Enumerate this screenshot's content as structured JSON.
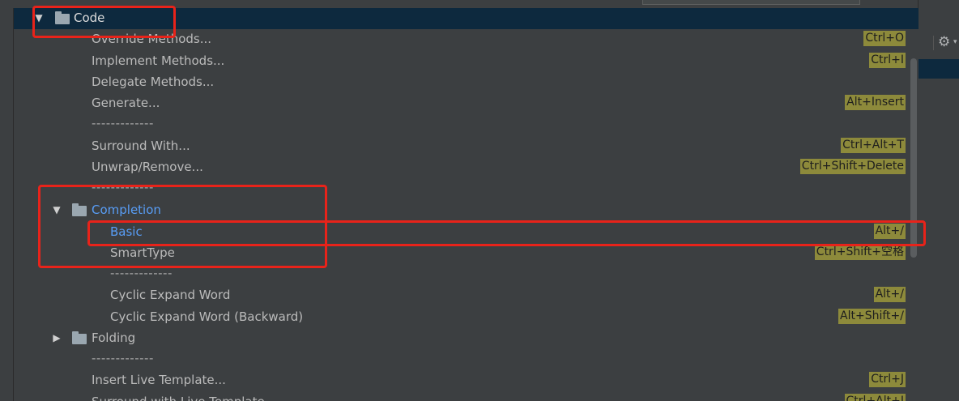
{
  "colors": {
    "background": "#3c3f41",
    "selection": "#0d293e",
    "text": "#bbbbbb",
    "link_blue": "#589df6",
    "shortcut_badge": "#8d8a3b",
    "highlight_red": "#e8231a"
  },
  "tree": {
    "code_folder": {
      "label": "Code",
      "expanded": true,
      "icon": "folder-icon"
    },
    "items": [
      {
        "label": "Override Methods...",
        "shortcut": "Ctrl+O"
      },
      {
        "label": "Implement Methods...",
        "shortcut": "Ctrl+I"
      },
      {
        "label": "Delegate Methods...",
        "shortcut": ""
      },
      {
        "label": "Generate...",
        "shortcut": "Alt+Insert"
      },
      {
        "label": "-------------",
        "shortcut": ""
      },
      {
        "label": "Surround With...",
        "shortcut": "Ctrl+Alt+T"
      },
      {
        "label": "Unwrap/Remove...",
        "shortcut": "Ctrl+Shift+Delete"
      },
      {
        "label": "-------------",
        "shortcut": ""
      }
    ],
    "completion_folder": {
      "label": "Completion",
      "expanded": true,
      "icon": "folder-icon"
    },
    "completion_items": [
      {
        "label": "Basic",
        "shortcut": "Alt+/"
      },
      {
        "label": "SmartType",
        "shortcut": "Ctrl+Shift+空格"
      },
      {
        "label": "-------------",
        "shortcut": ""
      },
      {
        "label": "Cyclic Expand Word",
        "shortcut": "Alt+/"
      },
      {
        "label": "Cyclic Expand Word (Backward)",
        "shortcut": "Alt+Shift+/"
      }
    ],
    "folding_folder": {
      "label": "Folding",
      "expanded": false,
      "icon": "folder-icon"
    },
    "after_items": [
      {
        "label": "-------------",
        "shortcut": ""
      },
      {
        "label": "Insert Live Template...",
        "shortcut": "Ctrl+J"
      },
      {
        "label": "Surround with Live Template...",
        "shortcut": "Ctrl+Alt+J"
      }
    ]
  },
  "toolbar": {
    "settings_icon": "gear-icon",
    "dropdown_glyph": "▾"
  }
}
